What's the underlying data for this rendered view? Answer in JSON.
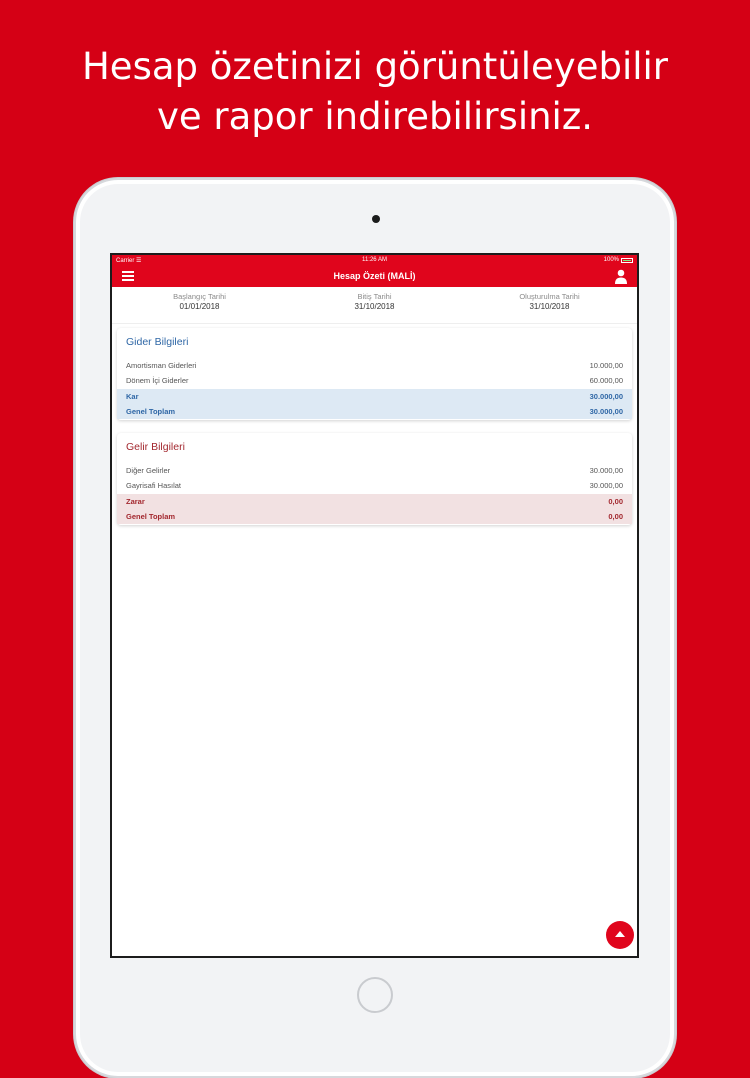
{
  "promo": {
    "line1": "Hesap özetinizi görüntüleyebilir",
    "line2": "ve rapor indirebilirsiniz."
  },
  "statusbar": {
    "carrier": "Carrier ☰",
    "time": "11:26 AM",
    "battery": "100%"
  },
  "navbar": {
    "title": "Hesap Özeti (MALİ)",
    "menu_icon": "hamburger-menu-icon",
    "user_icon": "user-icon"
  },
  "dates": [
    {
      "label": "Başlangıç Tarihi",
      "value": "01/01/2018"
    },
    {
      "label": "Bitiş Tarihi",
      "value": "31/10/2018"
    },
    {
      "label": "Oluşturulma Tarihi",
      "value": "31/10/2018"
    }
  ],
  "expense": {
    "title": "Gider Bilgileri",
    "rows": [
      {
        "label": "Amortisman Giderleri",
        "value": "10.000,00"
      },
      {
        "label": "Dönem İçi Giderler",
        "value": "60.000,00"
      }
    ],
    "totals": [
      {
        "label": "Kar",
        "value": "30.000,00"
      },
      {
        "label": "Genel Toplam",
        "value": "30.000,00"
      }
    ]
  },
  "income": {
    "title": "Gelir Bilgileri",
    "rows": [
      {
        "label": "Diğer Gelirler",
        "value": "30.000,00"
      },
      {
        "label": "Gayrisafi Hasılat",
        "value": "30.000,00"
      }
    ],
    "totals": [
      {
        "label": "Zarar",
        "value": "0,00"
      },
      {
        "label": "Genel Toplam",
        "value": "0,00"
      }
    ]
  },
  "fab": {
    "icon": "scroll-up-icon"
  },
  "colors": {
    "brand_red": "#d50015",
    "app_red": "#e0051c",
    "expense_blue": "#2f67a6",
    "expense_bg": "#dde9f4",
    "income_red": "#a3282f",
    "income_bg": "#f2e1e2"
  }
}
